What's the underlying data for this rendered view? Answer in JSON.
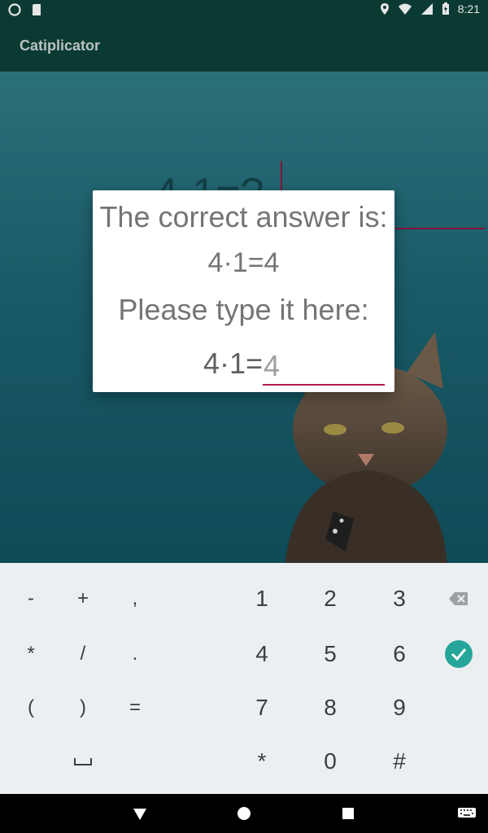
{
  "status_bar": {
    "time": "8:21"
  },
  "app_bar": {
    "title": "Catiplicator"
  },
  "background": {
    "question_text": "4·1=?"
  },
  "dialog": {
    "line1": "The correct answer is:",
    "line2": "4·1=4",
    "line3": "Please type it here:",
    "prefix": "4·1=",
    "input_value": "4"
  },
  "keyboard": {
    "row1": [
      "-",
      "+",
      ",",
      "1",
      "2",
      "3"
    ],
    "row2": [
      "*",
      "/",
      ".",
      "4",
      "5",
      "6"
    ],
    "row3": [
      "(",
      ")",
      "=",
      "7",
      "8",
      "9"
    ],
    "row4": [
      "*",
      "0",
      "#"
    ],
    "special": {
      "backspace_icon": "backspace-icon",
      "done_icon": "done-check-icon",
      "space_icon": "space-icon"
    }
  },
  "nav_bar": {
    "icons": [
      "back-icon",
      "home-icon",
      "recents-icon",
      "keyboard-switch-icon"
    ]
  },
  "colors": {
    "accent": "#b01b4e",
    "teal": "#26a69a",
    "app_bar": "#0b3a32"
  }
}
